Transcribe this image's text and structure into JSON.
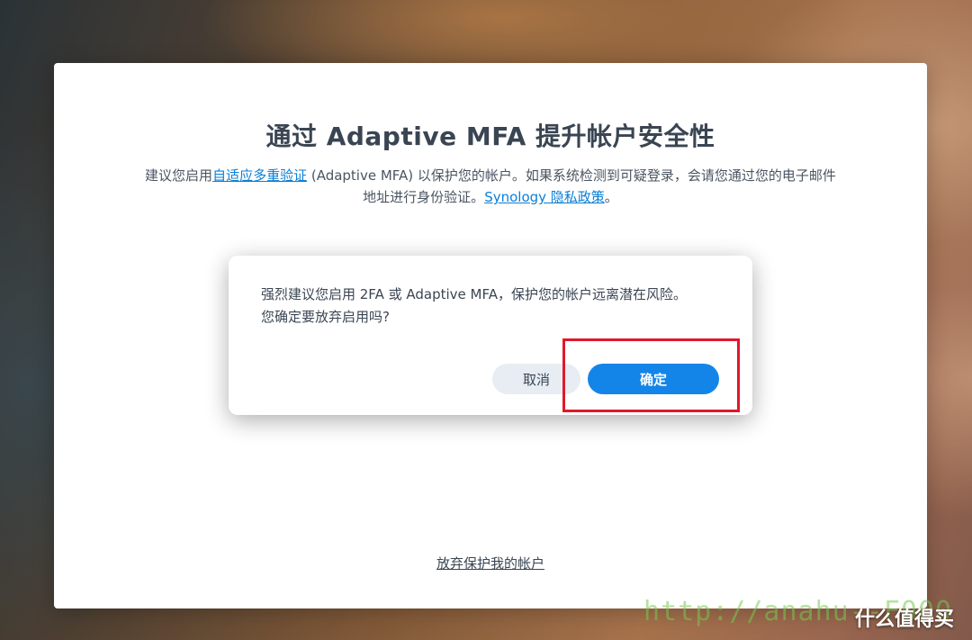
{
  "wizard": {
    "title": "通过 Adaptive MFA 提升帐户安全性",
    "desc_prefix": "建议您启用",
    "desc_link": "自适应多重验证",
    "desc_mid": " (Adaptive MFA) 以保护您的帐户。如果系统检测到可疑登录，会请您通过您的电子邮件地址进行身份验证。",
    "privacy_link": "Synology 隐私政策",
    "desc_suffix": "。",
    "abandon_link": "放弃保护我的帐户"
  },
  "dialog": {
    "line1": "强烈建议您启用 2FA 或 Adaptive MFA，保护您的帐户远离潜在风险。",
    "line2": "您确定要放弃启用吗?",
    "cancel_label": "取消",
    "confirm_label": "确定"
  },
  "overlay": {
    "watermark": "http://anahu--F000",
    "brand": "什么值得买"
  },
  "colors": {
    "accent": "#1485e8",
    "link": "#0a7fd6",
    "highlight": "#e0182a"
  }
}
